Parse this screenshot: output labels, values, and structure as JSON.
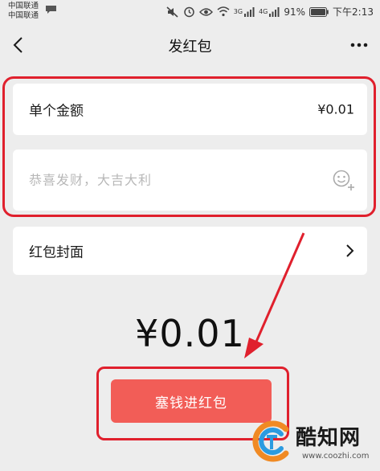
{
  "status_bar": {
    "carrier_1": "中国联通",
    "carrier_2": "中国联通",
    "network_1": "3G",
    "network_2": "4G",
    "battery": "91%",
    "time": "下午2:13"
  },
  "nav": {
    "title": "发红包"
  },
  "amount_row": {
    "label": "单个金额",
    "value": "¥0.01"
  },
  "greeting": {
    "placeholder": "恭喜发财，大吉大利"
  },
  "cover_row": {
    "label": "红包封面"
  },
  "total": {
    "amount": "¥0.01"
  },
  "submit": {
    "label": "塞钱进红包"
  },
  "watermark": {
    "text": "酷知网",
    "url": "www.coozhi.com"
  },
  "colors": {
    "accent": "#f25d57",
    "annotation": "#e0202d",
    "background": "#ededed"
  }
}
